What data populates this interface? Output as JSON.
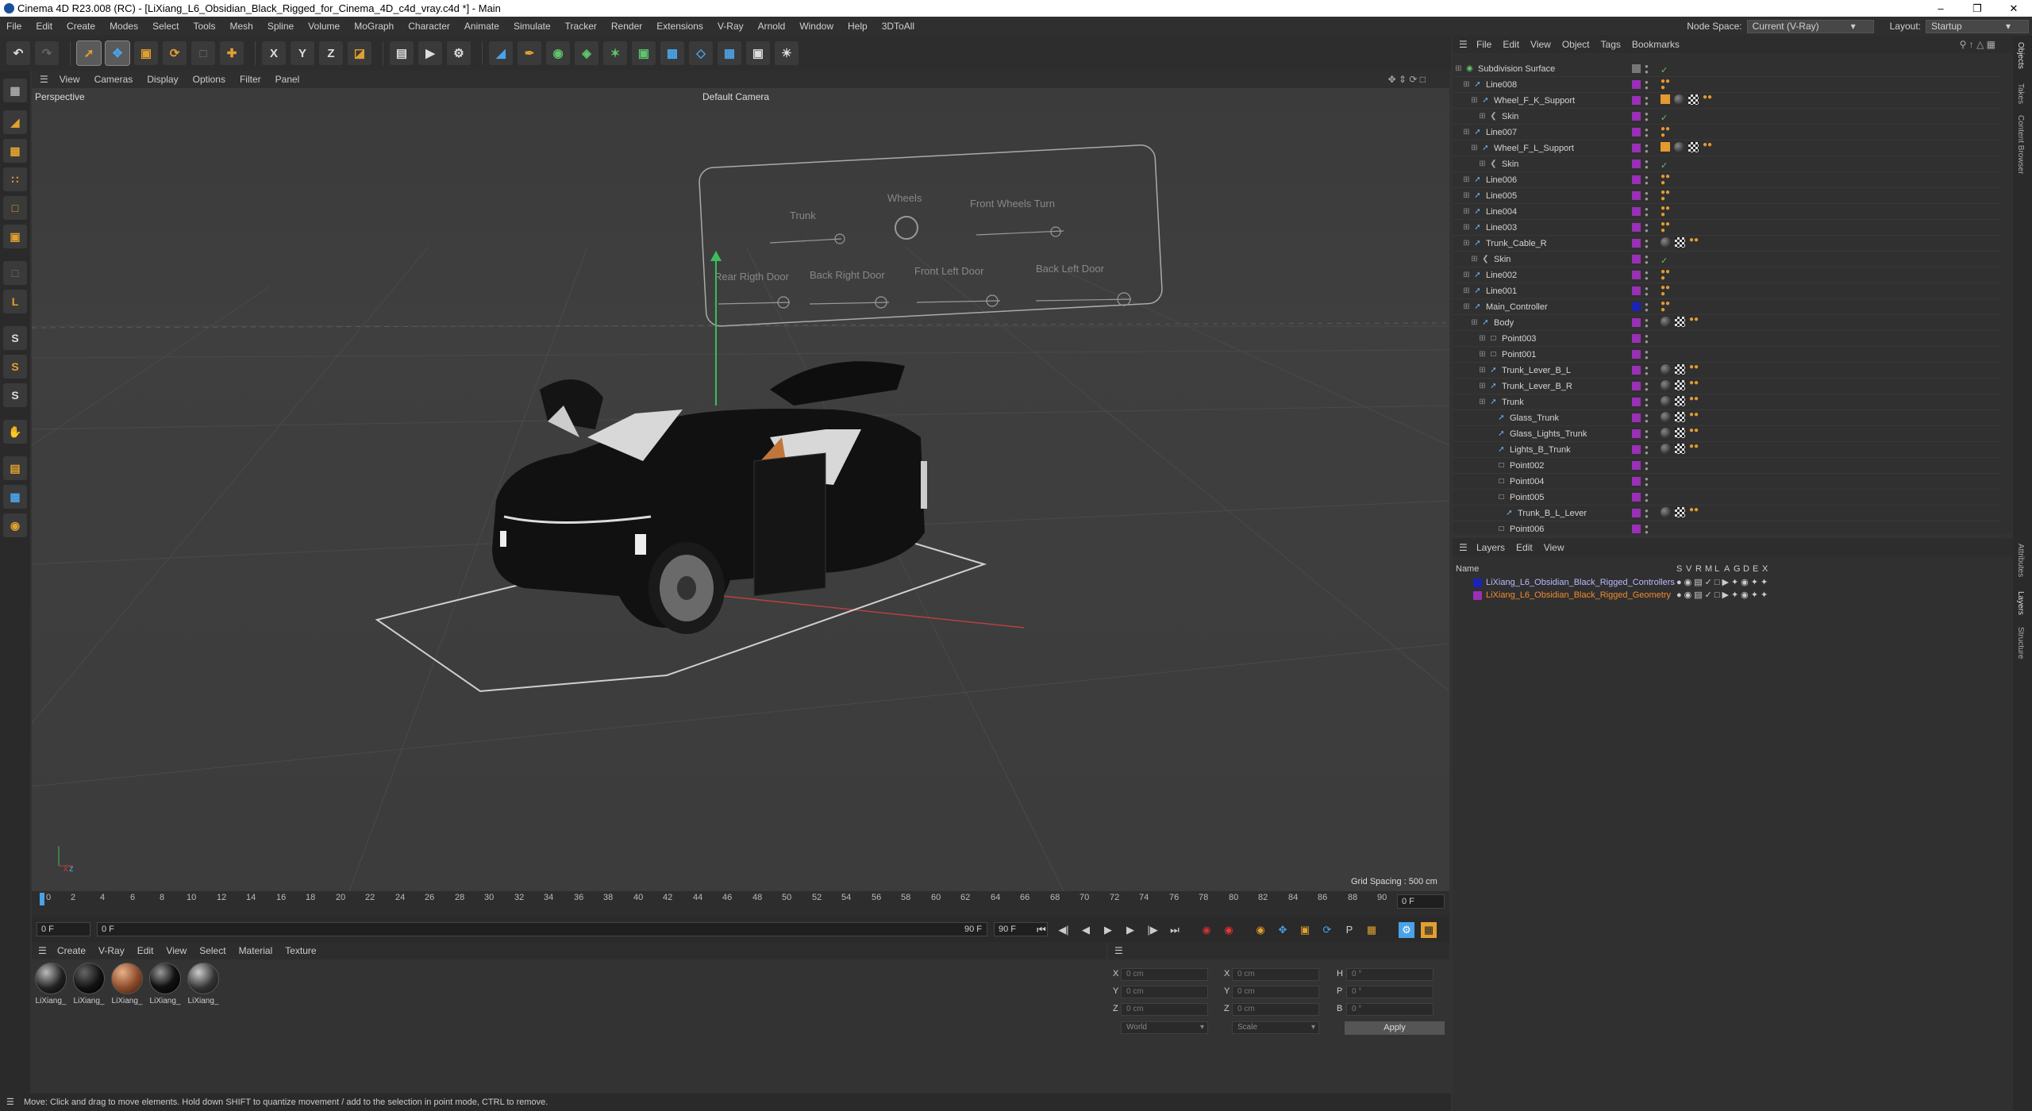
{
  "window": {
    "title": "Cinema 4D R23.008 (RC) - [LiXiang_L6_Obsidian_Black_Rigged_for_Cinema_4D_c4d_vray.c4d *] - Main"
  },
  "menubar": {
    "items": [
      "File",
      "Edit",
      "Create",
      "Modes",
      "Select",
      "Tools",
      "Mesh",
      "Spline",
      "Volume",
      "MoGraph",
      "Character",
      "Animate",
      "Simulate",
      "Tracker",
      "Render",
      "Extensions",
      "V-Ray",
      "Arnold",
      "Window",
      "Help",
      "3DToAll"
    ],
    "node_space_label": "Node Space:",
    "node_space_value": "Current (V-Ray)",
    "layout_label": "Layout:",
    "layout_value": "Startup"
  },
  "viewport": {
    "menu": [
      "View",
      "Cameras",
      "Display",
      "Options",
      "Filter",
      "Panel"
    ],
    "view_name": "Perspective",
    "camera_name": "Default Camera",
    "grid_spacing": "Grid Spacing : 500 cm",
    "panel_labels": [
      "Trunk",
      "Wheels",
      "Front Wheels Turn",
      "Rear Rigth Door",
      "Back Right Door",
      "Front Left Door",
      "Back Left Door"
    ]
  },
  "timeline": {
    "ticks": [
      "0",
      "2",
      "4",
      "6",
      "8",
      "10",
      "12",
      "14",
      "16",
      "18",
      "20",
      "22",
      "24",
      "26",
      "28",
      "30",
      "32",
      "34",
      "36",
      "38",
      "40",
      "42",
      "44",
      "46",
      "48",
      "50",
      "52",
      "54",
      "56",
      "58",
      "60",
      "62",
      "64",
      "66",
      "68",
      "70",
      "72",
      "74",
      "76",
      "78",
      "80",
      "82",
      "84",
      "86",
      "88",
      "90"
    ],
    "current_frame": "0 F"
  },
  "playback": {
    "start": "0 F",
    "current": "0 F",
    "end": "90 F",
    "end2": "90 F"
  },
  "materials": {
    "menu": [
      "Create",
      "V-Ray",
      "Edit",
      "View",
      "Select",
      "Material",
      "Texture"
    ],
    "items": [
      {
        "label": "LiXiang_",
        "style": "dark"
      },
      {
        "label": "LiXiang_",
        "style": "black"
      },
      {
        "label": "LiXiang_",
        "style": "brown"
      },
      {
        "label": "LiXiang_",
        "style": "black"
      },
      {
        "label": "LiXiang_",
        "style": "dark"
      }
    ]
  },
  "coords": {
    "labels": [
      "X",
      "Y",
      "Z",
      "X",
      "Y",
      "Z",
      "H",
      "P",
      "B"
    ],
    "pos": [
      "0 cm",
      "0 cm",
      "0 cm"
    ],
    "size": [
      "0 cm",
      "0 cm",
      "0 cm"
    ],
    "rot": [
      "0 °",
      "0 °",
      "0 °"
    ],
    "mode1": "World",
    "mode2": "Scale",
    "apply": "Apply"
  },
  "status": "Move: Click and drag to move elements. Hold down SHIFT to quantize movement / add to the selection in point mode, CTRL to remove.",
  "object_manager": {
    "menu": [
      "File",
      "Edit",
      "View",
      "Object",
      "Tags",
      "Bookmarks"
    ],
    "rows": [
      {
        "name": "Subdivision Surface",
        "indent": 0,
        "icon": "subdiv"
      },
      {
        "name": "Line008",
        "indent": 1,
        "icon": "spline"
      },
      {
        "name": "Wheel_F_K_Support",
        "indent": 2,
        "icon": "joint"
      },
      {
        "name": "Skin",
        "indent": 3,
        "icon": "skin"
      },
      {
        "name": "Line007",
        "indent": 1,
        "icon": "spline"
      },
      {
        "name": "Wheel_F_L_Support",
        "indent": 2,
        "icon": "joint"
      },
      {
        "name": "Skin",
        "indent": 3,
        "icon": "skin"
      },
      {
        "name": "Line006",
        "indent": 1,
        "icon": "spline"
      },
      {
        "name": "Line005",
        "indent": 1,
        "icon": "spline"
      },
      {
        "name": "Line004",
        "indent": 1,
        "icon": "spline"
      },
      {
        "name": "Line003",
        "indent": 1,
        "icon": "spline"
      },
      {
        "name": "Trunk_Cable_R",
        "indent": 1,
        "icon": "joint"
      },
      {
        "name": "Skin",
        "indent": 2,
        "icon": "skin"
      },
      {
        "name": "Line002",
        "indent": 1,
        "icon": "spline"
      },
      {
        "name": "Line001",
        "indent": 1,
        "icon": "spline"
      },
      {
        "name": "Main_Controller",
        "indent": 1,
        "icon": "spline"
      },
      {
        "name": "Body",
        "indent": 2,
        "icon": "joint"
      },
      {
        "name": "Point003",
        "indent": 3,
        "icon": "null"
      },
      {
        "name": "Point001",
        "indent": 3,
        "icon": "null"
      },
      {
        "name": "Trunk_Lever_B_L",
        "indent": 3,
        "icon": "joint"
      },
      {
        "name": "Trunk_Lever_B_R",
        "indent": 3,
        "icon": "joint"
      },
      {
        "name": "Trunk",
        "indent": 3,
        "icon": "joint"
      },
      {
        "name": "Glass_Trunk",
        "indent": 4,
        "icon": "joint"
      },
      {
        "name": "Glass_Lights_Trunk",
        "indent": 4,
        "icon": "joint"
      },
      {
        "name": "Lights_B_Trunk",
        "indent": 4,
        "icon": "joint"
      },
      {
        "name": "Point002",
        "indent": 4,
        "icon": "null"
      },
      {
        "name": "Point004",
        "indent": 4,
        "icon": "null"
      },
      {
        "name": "Point005",
        "indent": 4,
        "icon": "null"
      },
      {
        "name": "Trunk_B_L_Lever",
        "indent": 5,
        "icon": "joint"
      },
      {
        "name": "Point006",
        "indent": 4,
        "icon": "null"
      }
    ]
  },
  "layers": {
    "menu": [
      "Layers",
      "Edit",
      "View"
    ],
    "columns": [
      "Name",
      "S",
      "V",
      "R",
      "M",
      "L",
      "A",
      "G",
      "D",
      "E",
      "X"
    ],
    "rows": [
      {
        "name": "LiXiang_L6_Obsidian_Black_Rigged_Controllers",
        "color": "#1a23b8"
      },
      {
        "name": "LiXiang_L6_Obsidian_Black_Rigged_Geometry",
        "color": "#9a2fb8"
      }
    ]
  },
  "side_tabs": [
    "Objects",
    "Takes",
    "Content Browser",
    "Attributes",
    "Layers",
    "Structure"
  ]
}
